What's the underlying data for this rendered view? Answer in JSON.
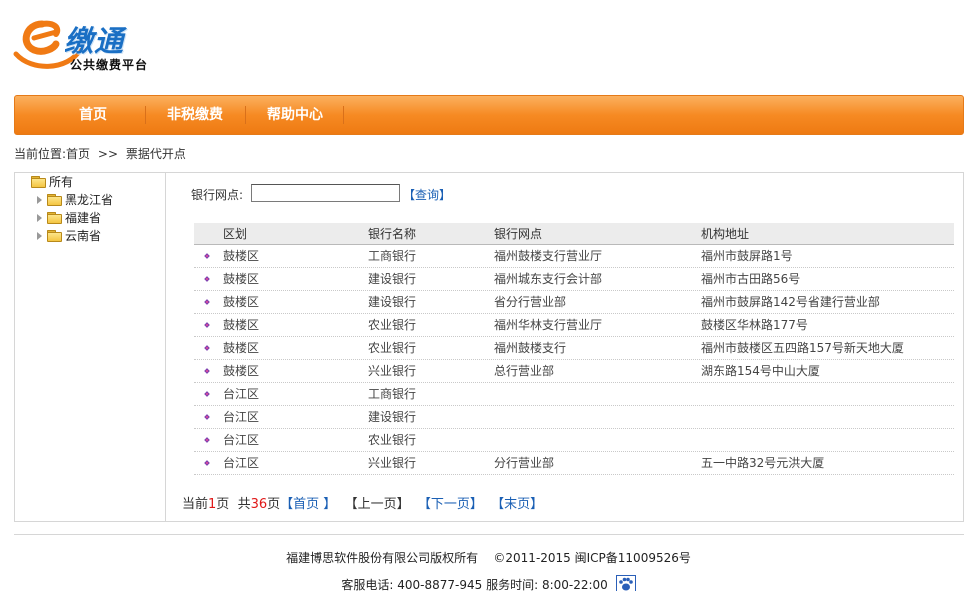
{
  "logo": {
    "main": "缴通",
    "letter": "e",
    "sub": "公共缴费平台"
  },
  "nav": {
    "items": [
      {
        "label": "首页"
      },
      {
        "label": "非税缴费"
      },
      {
        "label": "帮助中心"
      }
    ]
  },
  "breadcrumb": {
    "prefix": "当前位置:",
    "home": "首页",
    "separator": ">>",
    "current": "票据代开点"
  },
  "tree": {
    "root": "所有",
    "children": [
      "黑龙江省",
      "福建省",
      "云南省"
    ]
  },
  "search": {
    "label": "银行网点:",
    "value": "",
    "button": "【查询】"
  },
  "table": {
    "headers": [
      "区划",
      "银行名称",
      "银行网点",
      "机构地址"
    ],
    "rows": [
      [
        "鼓楼区",
        "工商银行",
        "福州鼓楼支行营业厅",
        "福州市鼓屏路1号"
      ],
      [
        "鼓楼区",
        "建设银行",
        "福州城东支行会计部",
        "福州市古田路56号"
      ],
      [
        "鼓楼区",
        "建设银行",
        "省分行营业部",
        "福州市鼓屏路142号省建行营业部"
      ],
      [
        "鼓楼区",
        "农业银行",
        "福州华林支行营业厅",
        "鼓楼区华林路177号"
      ],
      [
        "鼓楼区",
        "农业银行",
        "福州鼓楼支行",
        "福州市鼓楼区五四路157号新天地大厦"
      ],
      [
        "鼓楼区",
        "兴业银行",
        "总行营业部",
        "湖东路154号中山大厦"
      ],
      [
        "台江区",
        "工商银行",
        "",
        ""
      ],
      [
        "台江区",
        "建设银行",
        "",
        ""
      ],
      [
        "台江区",
        "农业银行",
        "",
        ""
      ],
      [
        "台江区",
        "兴业银行",
        "分行营业部",
        "五一中路32号元洪大厦"
      ]
    ]
  },
  "pager": {
    "current_prefix": "当前",
    "current_page": "1",
    "page_unit": "页",
    "total_prefix": "共",
    "total_pages": "36",
    "first": "【首页 】",
    "prev": "【上一页】",
    "next": "【下一页】",
    "last": "【末页】"
  },
  "footer": {
    "copyright": "福建博思软件股份有限公司版权所有",
    "years_icp": "©2011-2015 闽ICP备11009526号",
    "phone_label": "客服电话:",
    "phone": "400-8877-945",
    "hours_label": "服务时间:",
    "hours": "8:00-22:00"
  },
  "colors": {
    "nav": "#f68a23",
    "link": "#1a5fb4",
    "page_num": "#e01818",
    "logo": "#1a6fc4"
  }
}
